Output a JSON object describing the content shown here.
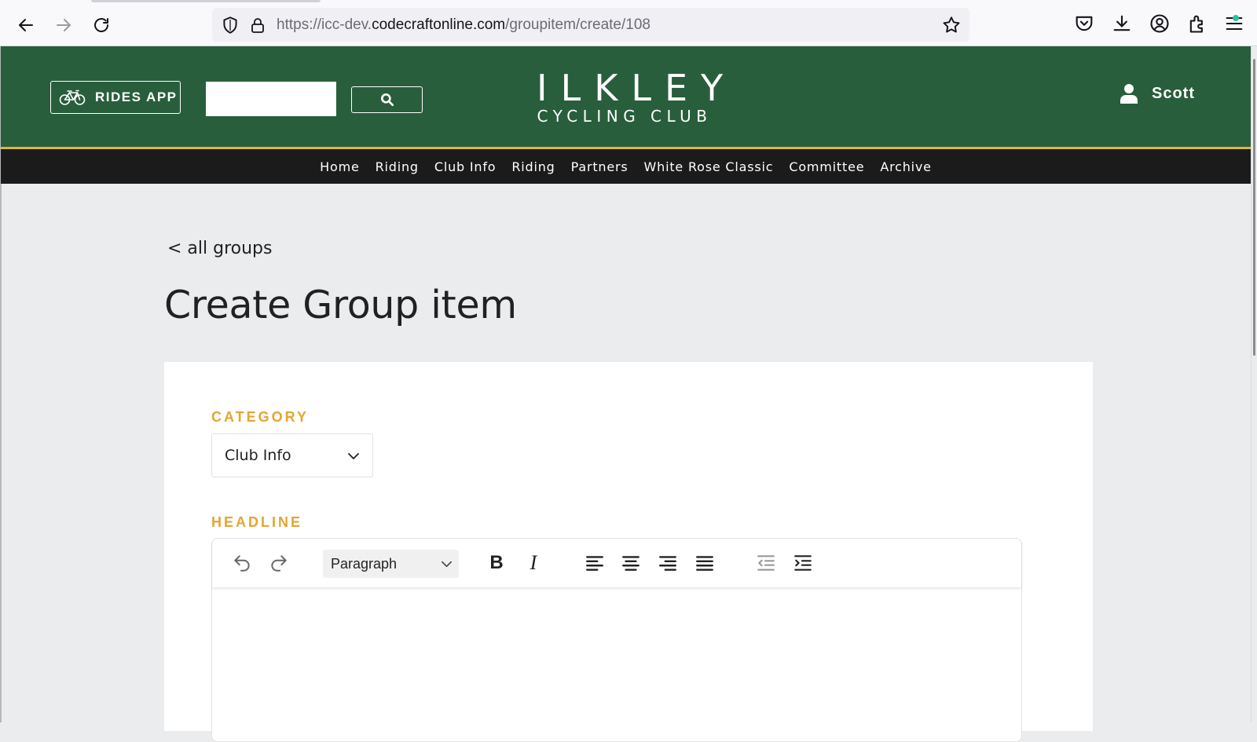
{
  "browser": {
    "url_prefix": "https://icc-dev.",
    "url_host": "codecraftonline.com",
    "url_path": "/groupitem/create/108",
    "icons": [
      "back-arrow-icon",
      "forward-arrow-icon",
      "reload-icon",
      "shield-icon",
      "lock-icon",
      "bookmark-star-icon",
      "pocket-icon",
      "download-icon",
      "account-icon",
      "extensions-icon",
      "menu-icon"
    ]
  },
  "header": {
    "rides_app_label": "RIDES APP",
    "search_placeholder": "",
    "logo_line1": "ILKLEY",
    "logo_line2": "CYCLING CLUB",
    "user_name": "Scott",
    "colors": {
      "header_bg": "#285e3c",
      "accent": "#e3b33a",
      "nav_bg": "#1b1b1b"
    }
  },
  "nav": {
    "items": [
      "Home",
      "Riding",
      "Club Info",
      "Riding",
      "Partners",
      "White Rose Classic",
      "Committee",
      "Archive"
    ]
  },
  "main": {
    "back_link": "< all groups",
    "title": "Create Group item",
    "category_label": "CATEGORY",
    "category_value": "Club Info",
    "headline_label": "HEADLINE",
    "label_color": "#e3a632"
  },
  "editor": {
    "block_format": "Paragraph",
    "bold_label": "B",
    "italic_label": "I",
    "tools": [
      "undo-icon",
      "redo-icon",
      "bold",
      "italic",
      "align-left-icon",
      "align-center-icon",
      "align-right-icon",
      "align-justify-icon",
      "outdent-icon",
      "indent-icon"
    ]
  }
}
